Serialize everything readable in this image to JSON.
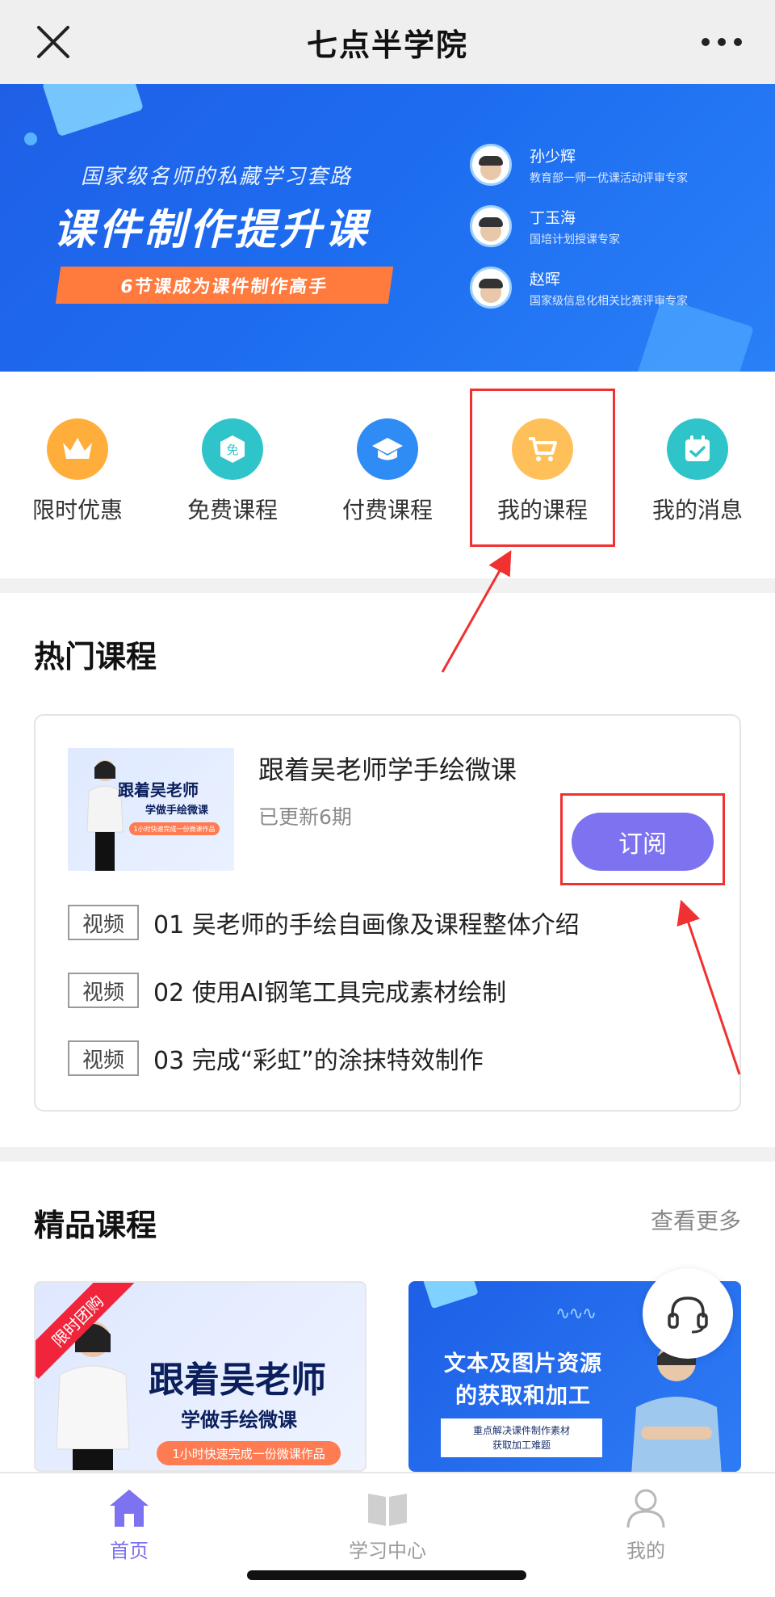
{
  "header": {
    "title": "七点半学院"
  },
  "banner": {
    "subtitle": "国家级名师的私藏学习套路",
    "title": "课件制作提升课",
    "ribbon": "6节课成为课件制作高手",
    "teachers": [
      {
        "name": "孙少辉",
        "desc": "教育部一师一优课活动评审专家"
      },
      {
        "name": "丁玉海",
        "desc": "国培计划授课专家"
      },
      {
        "name": "赵晖",
        "desc": "国家级信息化相关比赛评审专家"
      }
    ]
  },
  "menu": {
    "items": [
      {
        "label": "限时优惠",
        "icon": "crown-icon",
        "color": "#ffae3b"
      },
      {
        "label": "免费课程",
        "icon": "free-tag-icon",
        "color": "#2fc4c9"
      },
      {
        "label": "付费课程",
        "icon": "graduation-cap-icon",
        "color": "#2f8cf5"
      },
      {
        "label": "我的课程",
        "icon": "cart-icon",
        "color": "#ffc05a"
      },
      {
        "label": "我的消息",
        "icon": "calendar-check-icon",
        "color": "#2fc4c9"
      }
    ]
  },
  "hot": {
    "section_title": "热门课程",
    "thumb": {
      "line1": "跟着吴老师",
      "line2": "学做手绘微课",
      "line3": "1小时快速完成一份微课作品"
    },
    "course_title": "跟着吴老师学手绘微课",
    "course_sub": "已更新6期",
    "subscribe_label": "订阅",
    "lessons": [
      {
        "tag": "视频",
        "title": "01 吴老师的手绘自画像及课程整体介绍"
      },
      {
        "tag": "视频",
        "title": "02 使用AI钢笔工具完成素材绘制"
      },
      {
        "tag": "视频",
        "title": "03 完成“彩虹”的涂抹特效制作"
      }
    ]
  },
  "premium": {
    "section_title": "精品课程",
    "more_label": "查看更多",
    "card_a": {
      "badge": "限时团购",
      "line1": "跟着吴老师",
      "line2": "学做手绘微课",
      "pill": "1小时快速完成一份微课作品"
    },
    "card_b": {
      "line1": "文本及图片资源",
      "line2": "的获取和加工",
      "note1": "重点解决课件制作素材",
      "note2": "获取加工难题"
    }
  },
  "tabbar": {
    "items": [
      {
        "label": "首页",
        "icon": "home-icon",
        "active": true
      },
      {
        "label": "学习中心",
        "icon": "book-icon",
        "active": false
      },
      {
        "label": "我的",
        "icon": "user-icon",
        "active": false
      }
    ]
  },
  "colors": {
    "accent": "#7d72ef",
    "annotation": "#f03131",
    "banner": "#1f5fe6"
  }
}
